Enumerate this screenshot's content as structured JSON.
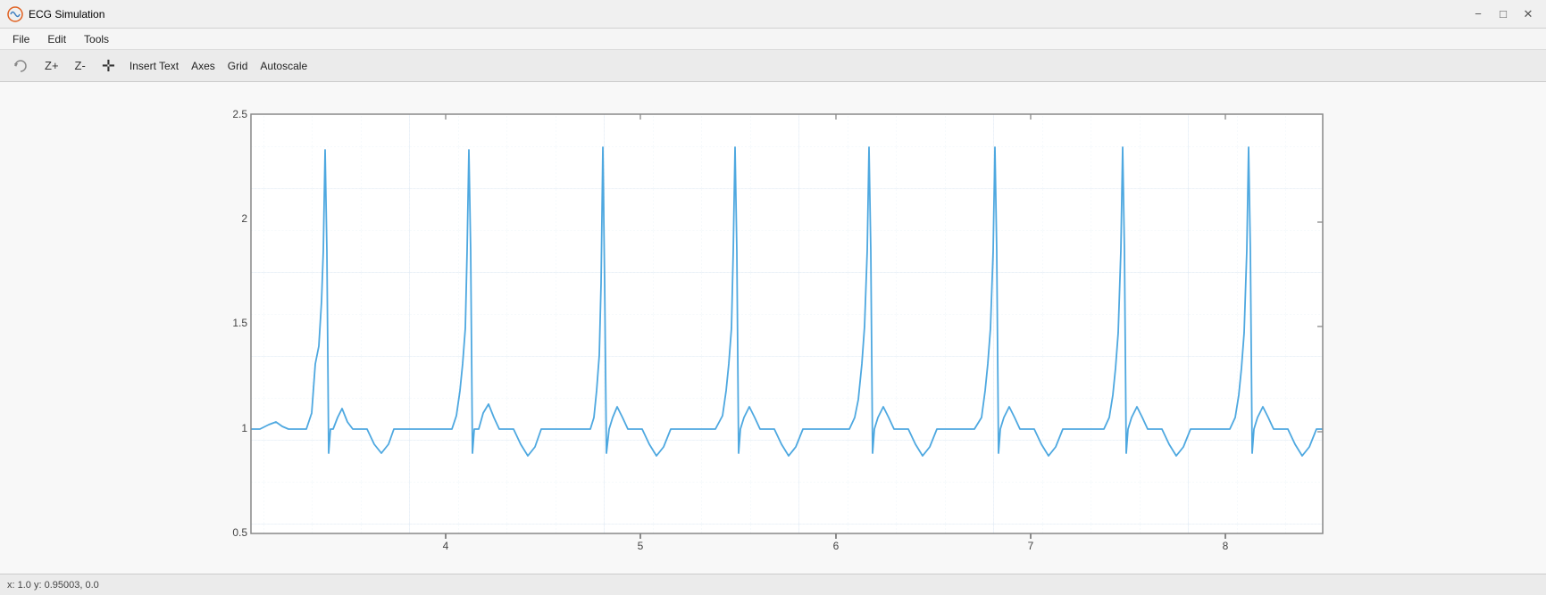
{
  "window": {
    "title": "ECG Simulation",
    "minimize_label": "−",
    "maximize_label": "□",
    "close_label": "✕"
  },
  "menu": {
    "items": [
      {
        "label": "File",
        "id": "file"
      },
      {
        "label": "Edit",
        "id": "edit"
      },
      {
        "label": "Tools",
        "id": "tools"
      }
    ]
  },
  "toolbar": {
    "zoom_in": "Z+",
    "zoom_out": "Z-",
    "insert_text": "Insert Text",
    "axes": "Axes",
    "grid": "Grid",
    "autoscale": "Autoscale"
  },
  "chart": {
    "y_labels": [
      "2.5",
      "2",
      "1.5",
      "1",
      "0.5"
    ],
    "x_labels": [
      "4",
      "5",
      "6",
      "7",
      "8"
    ],
    "accent_color": "#4ea8e0"
  },
  "status_bar": {
    "text": "x: 1.0    y: 0.95003, 0.0"
  }
}
